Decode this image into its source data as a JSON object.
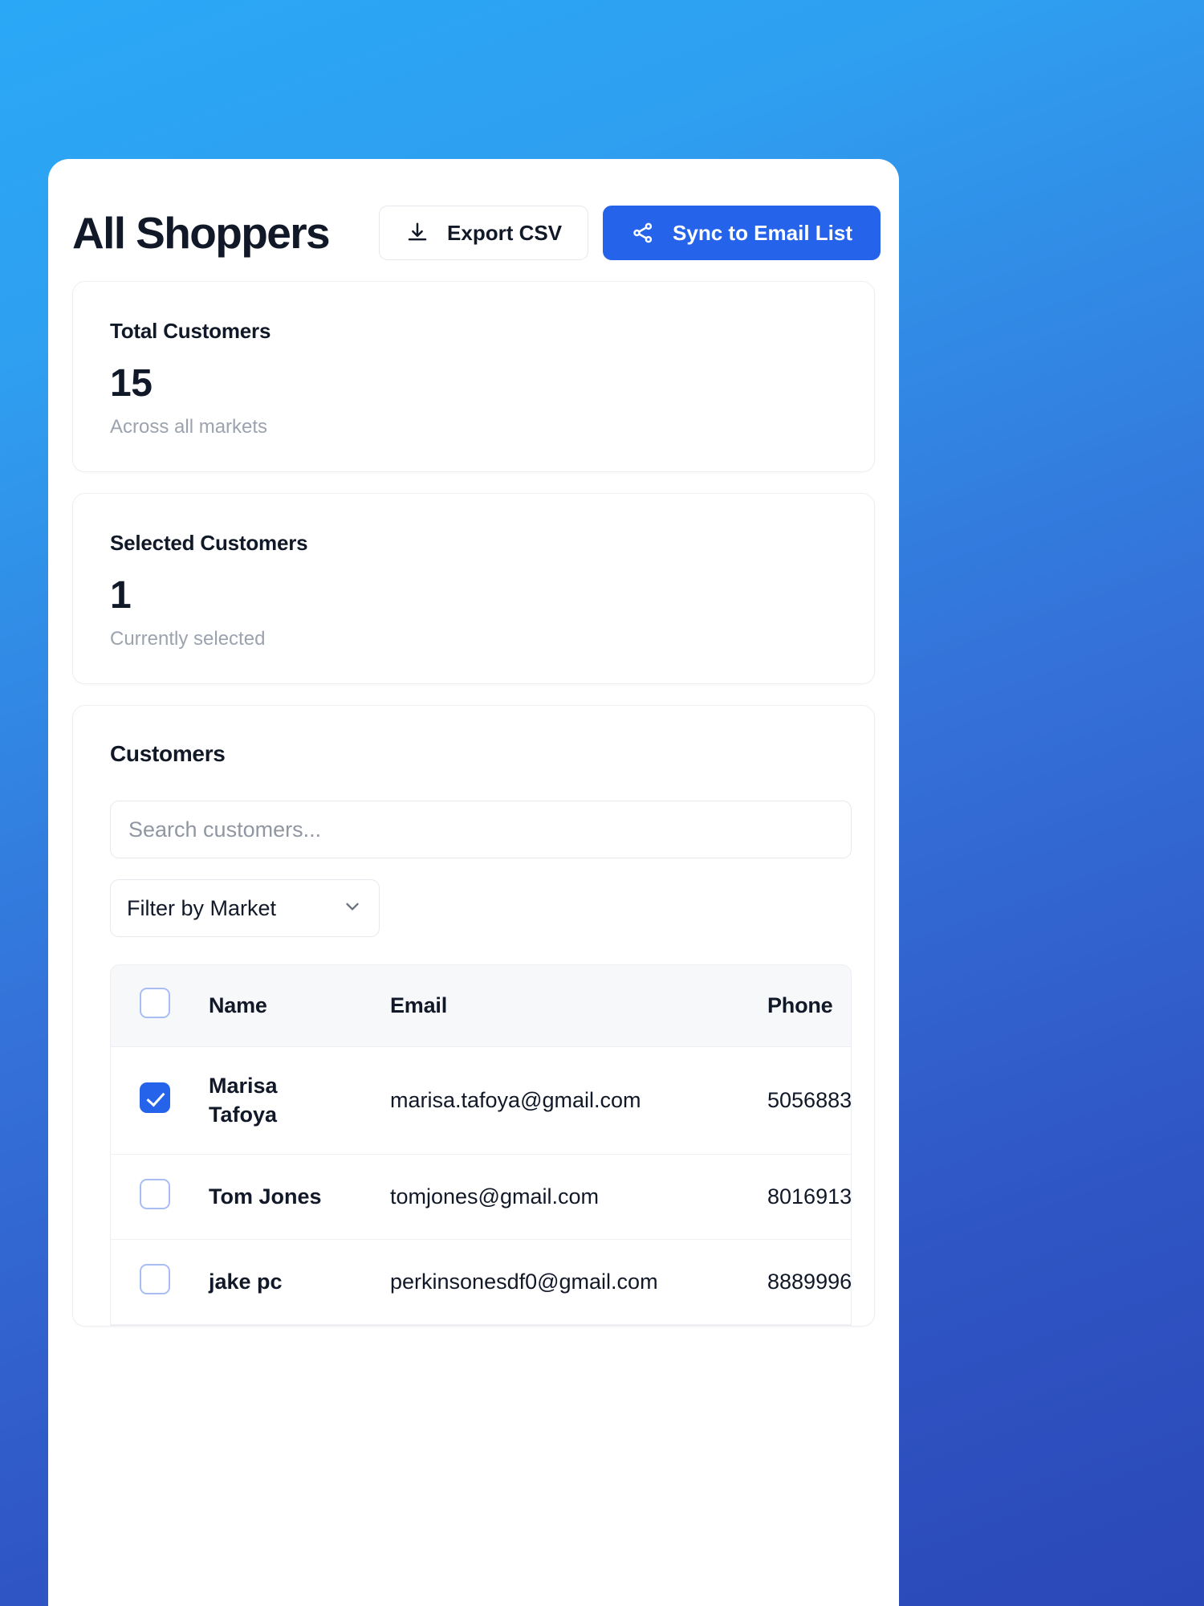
{
  "header": {
    "title": "All Shoppers",
    "export_label": "Export CSV",
    "sync_label": "Sync to Email List"
  },
  "stats": [
    {
      "label": "Total Customers",
      "value": "15",
      "sub": "Across all markets"
    },
    {
      "label": "Selected Customers",
      "value": "1",
      "sub": "Currently selected"
    }
  ],
  "customers_panel": {
    "title": "Customers",
    "search_placeholder": "Search customers...",
    "search_value": "",
    "filter_label": "Filter by Market",
    "columns": [
      "Name",
      "Email",
      "Phone"
    ],
    "rows": [
      {
        "selected": true,
        "name": "Marisa Tafoya",
        "name_line1": "Marisa",
        "name_line2": "Tafoya",
        "email": "marisa.tafoya@gmail.com",
        "phone": "5056883"
      },
      {
        "selected": false,
        "name": "Tom Jones",
        "name_line1": "Tom Jones",
        "name_line2": "",
        "email": "tomjones@gmail.com",
        "phone": "8016913"
      },
      {
        "selected": false,
        "name": "jake pc",
        "name_line1": "jake pc",
        "name_line2": "",
        "email": "perkinsonesdf0@gmail.com",
        "phone": "8889996"
      }
    ]
  },
  "colors": {
    "accent": "#2563eb",
    "text": "#111827",
    "muted": "#9ca3af",
    "border": "#e6e8ee",
    "background_top": "#2aa8f7",
    "background_bottom": "#2b48b8"
  }
}
